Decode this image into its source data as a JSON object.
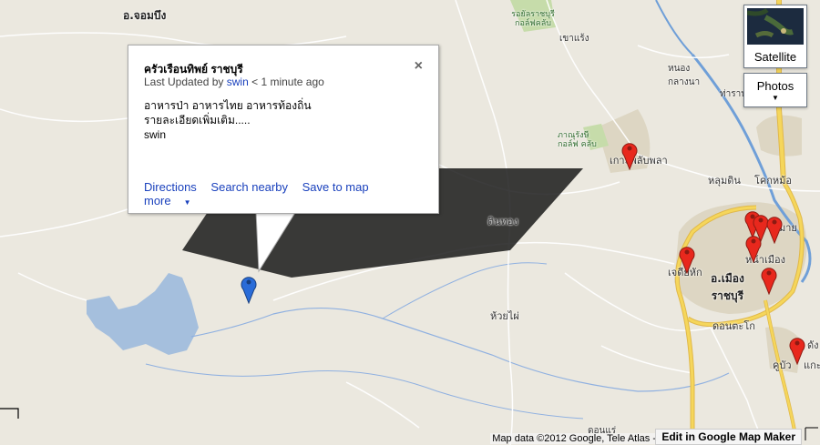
{
  "map": {
    "labels": {
      "chom_bueng": "อ.จอมบึง",
      "golf_top": "รอยัลราชบุรี\nกอล์ฟคลับ",
      "khao_raeng": "เขาแร้ง",
      "nong_klang_na": "หนอง\nกลางนา",
      "tha_rap": "ท่าราบ",
      "golf_mid": "ภาณุรังษี\nกอล์ฟ คลับ",
      "ko_phlapphla": "เกาะพลับพลา",
      "lum_din": "หลุมดิน",
      "khok_mo": "โคกหม้อ",
      "tin_thong": "ตินทอง",
      "na_mueang": "หน้าเมือง",
      "chedi_hak": "เจดีย์หัก",
      "amphoe_mueang": "อ.เมือง\nราชบุรี",
      "huai_phai": "ห้วยไผ่",
      "don_takhro": "ดอนตะโก",
      "ku_bua": "คูบัว",
      "don_rae": "ดอนแร่",
      "dang": "ดัง",
      "kae": "แกะ",
      "hi_way": "มาย"
    }
  },
  "infowindow": {
    "title": "ครัวเรือนทิพย์ ราชบุรี",
    "updated_prefix": "Last Updated by",
    "updated_user": "swin",
    "updated_suffix": "< 1 minute ago",
    "desc_line1": "อาหารป่า อาหารไทย อาหารท้องถิ่น",
    "desc_line2": "รายละเอียดเพิ่มเติม.....",
    "desc_line3": "swin",
    "close_glyph": "×",
    "actions": {
      "directions": "Directions",
      "search_nearby": "Search nearby",
      "save_to_map": "Save to map",
      "more": "more",
      "more_caret": "▼"
    }
  },
  "controls": {
    "satellite": "Satellite",
    "photos": "Photos",
    "photos_caret": "▼"
  },
  "footer": {
    "copyright": "Map data ©2012 Google, Tele Atlas -",
    "mapmaker": "Edit in Google Map Maker"
  },
  "colors": {
    "water": "#a5bfdd",
    "road_yellow": "#f5d65b",
    "road_outline": "#e0b84a",
    "river": "#6f9fd8",
    "urban": "#d9d3c1",
    "park": "#c9dfae",
    "marker_red": "#e8281d",
    "marker_blue": "#2a6cd8"
  }
}
